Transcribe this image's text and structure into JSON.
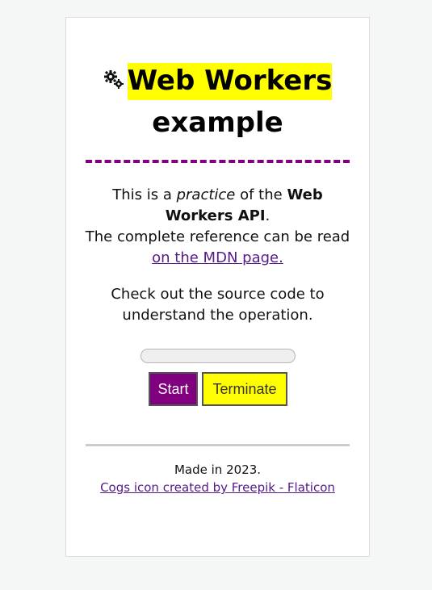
{
  "header": {
    "icon": "cogs-icon",
    "title_highlight": "Web Workers",
    "title_rest": "example",
    "highlight_color": "#ffff00"
  },
  "intro": {
    "line1_pre": "This is a ",
    "line1_em": "practice",
    "line1_mid": " of the ",
    "line1_strong": "Web Workers API",
    "line1_end": ".",
    "line2": "The complete reference can be read",
    "link_text": "on the MDN page."
  },
  "instructions": "Check out the source code to understand the operation.",
  "progress": {
    "value": 0
  },
  "buttons": {
    "start_label": "Start",
    "terminate_label": "Terminate"
  },
  "footer": {
    "made_in": "Made in 2023.",
    "credit_link": "Cogs icon created by Freepik - Flaticon"
  },
  "colors": {
    "accent": "#800080",
    "highlight": "#ffff00",
    "link": "#551a8b"
  }
}
